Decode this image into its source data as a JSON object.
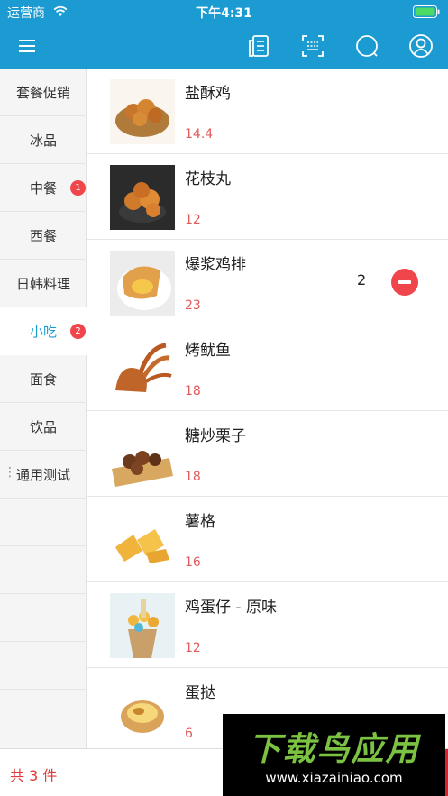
{
  "status_bar": {
    "carrier": "运营商",
    "time": "下午4:31"
  },
  "nav": {
    "icons": [
      "menu-icon",
      "order-list-icon",
      "scan-icon",
      "search-icon",
      "user-icon"
    ]
  },
  "categories": [
    {
      "label": "套餐促销"
    },
    {
      "label": "冰品"
    },
    {
      "label": "中餐",
      "badge": "1"
    },
    {
      "label": "西餐"
    },
    {
      "label": "日韩料理"
    },
    {
      "label": "小吃",
      "badge": "2",
      "active": true
    },
    {
      "label": "面食"
    },
    {
      "label": "饮品"
    },
    {
      "label": "通用测试"
    }
  ],
  "products": [
    {
      "name": "盐酥鸡",
      "price": "14.4"
    },
    {
      "name": "花枝丸",
      "price": "12"
    },
    {
      "name": "爆浆鸡排",
      "price": "23",
      "quantity": "2"
    },
    {
      "name": "烤鱿鱼",
      "price": "18"
    },
    {
      "name": "糖炒栗子",
      "price": "18"
    },
    {
      "name": "薯格",
      "price": "16"
    },
    {
      "name": "鸡蛋仔 - 原味",
      "price": "12"
    },
    {
      "name": "蛋挞",
      "price": "6"
    }
  ],
  "cart": {
    "total_label": "共 3 件"
  },
  "watermark": {
    "title": "下载鸟应用",
    "url": "www.xiazainiao.com"
  },
  "colors": {
    "brand": "#1b9bd1",
    "price": "#e25b5b",
    "badge": "#f0464b",
    "total": "#e03a3a"
  }
}
